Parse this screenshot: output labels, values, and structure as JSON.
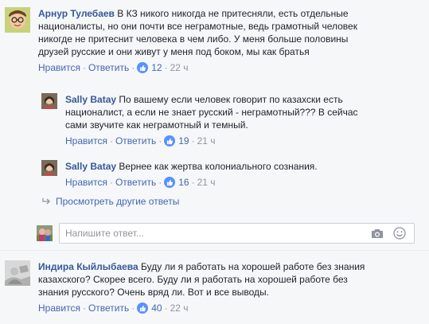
{
  "comments": [
    {
      "author": "Арнур Тулебаев",
      "lines": [
        "В КЗ никого никогда не притесняли, есть отдельные",
        "националисты, но они почти все неграмотные, ведь грамотный человек",
        "никогде не притеснит человека в чем либо. У меня больше половины",
        "друзей русские и они живут у меня под боком, мы как братья"
      ],
      "like_label": "Нравится",
      "reply_label": "Ответить",
      "like_count": "12",
      "time": "22 ч"
    },
    {
      "author": "Sally Batay",
      "lines": [
        "По вашему если человек говорит по казахски есть",
        "националист, а если не знает русский - неграмотный??? В сейчас",
        "сами звучите как неграмотный и темный."
      ],
      "like_label": "Нравится",
      "reply_label": "Ответить",
      "like_count": "19",
      "time": "21 ч"
    },
    {
      "author": "Sally Batay",
      "lines": [
        "Вернее как жертва колониального сознания."
      ],
      "like_label": "Нравится",
      "reply_label": "Ответить",
      "like_count": "16",
      "time": "21 ч"
    },
    {
      "author": "Индира Кыйлыбаева",
      "lines": [
        "Буду ли я работать на хорошей работе без знания",
        "казахского? Скорее всего. Буду ли я работать на хорошей работе без",
        "знания русского? Очень вряд ли. Вот и все выводы."
      ],
      "like_label": "Нравится",
      "reply_label": "Ответить",
      "like_count": "40",
      "time": "22 ч"
    }
  ],
  "more_replies": "Просмотреть другие ответы",
  "composer": {
    "placeholder": "Напишите ответ..."
  },
  "colors": {
    "link": "#4267b2",
    "name": "#365899",
    "meta": "#90949c",
    "like_badge": "#5890ff"
  },
  "icons": [
    "reply-arrow-icon",
    "camera-icon",
    "smiley-icon",
    "like-thumb-icon"
  ]
}
